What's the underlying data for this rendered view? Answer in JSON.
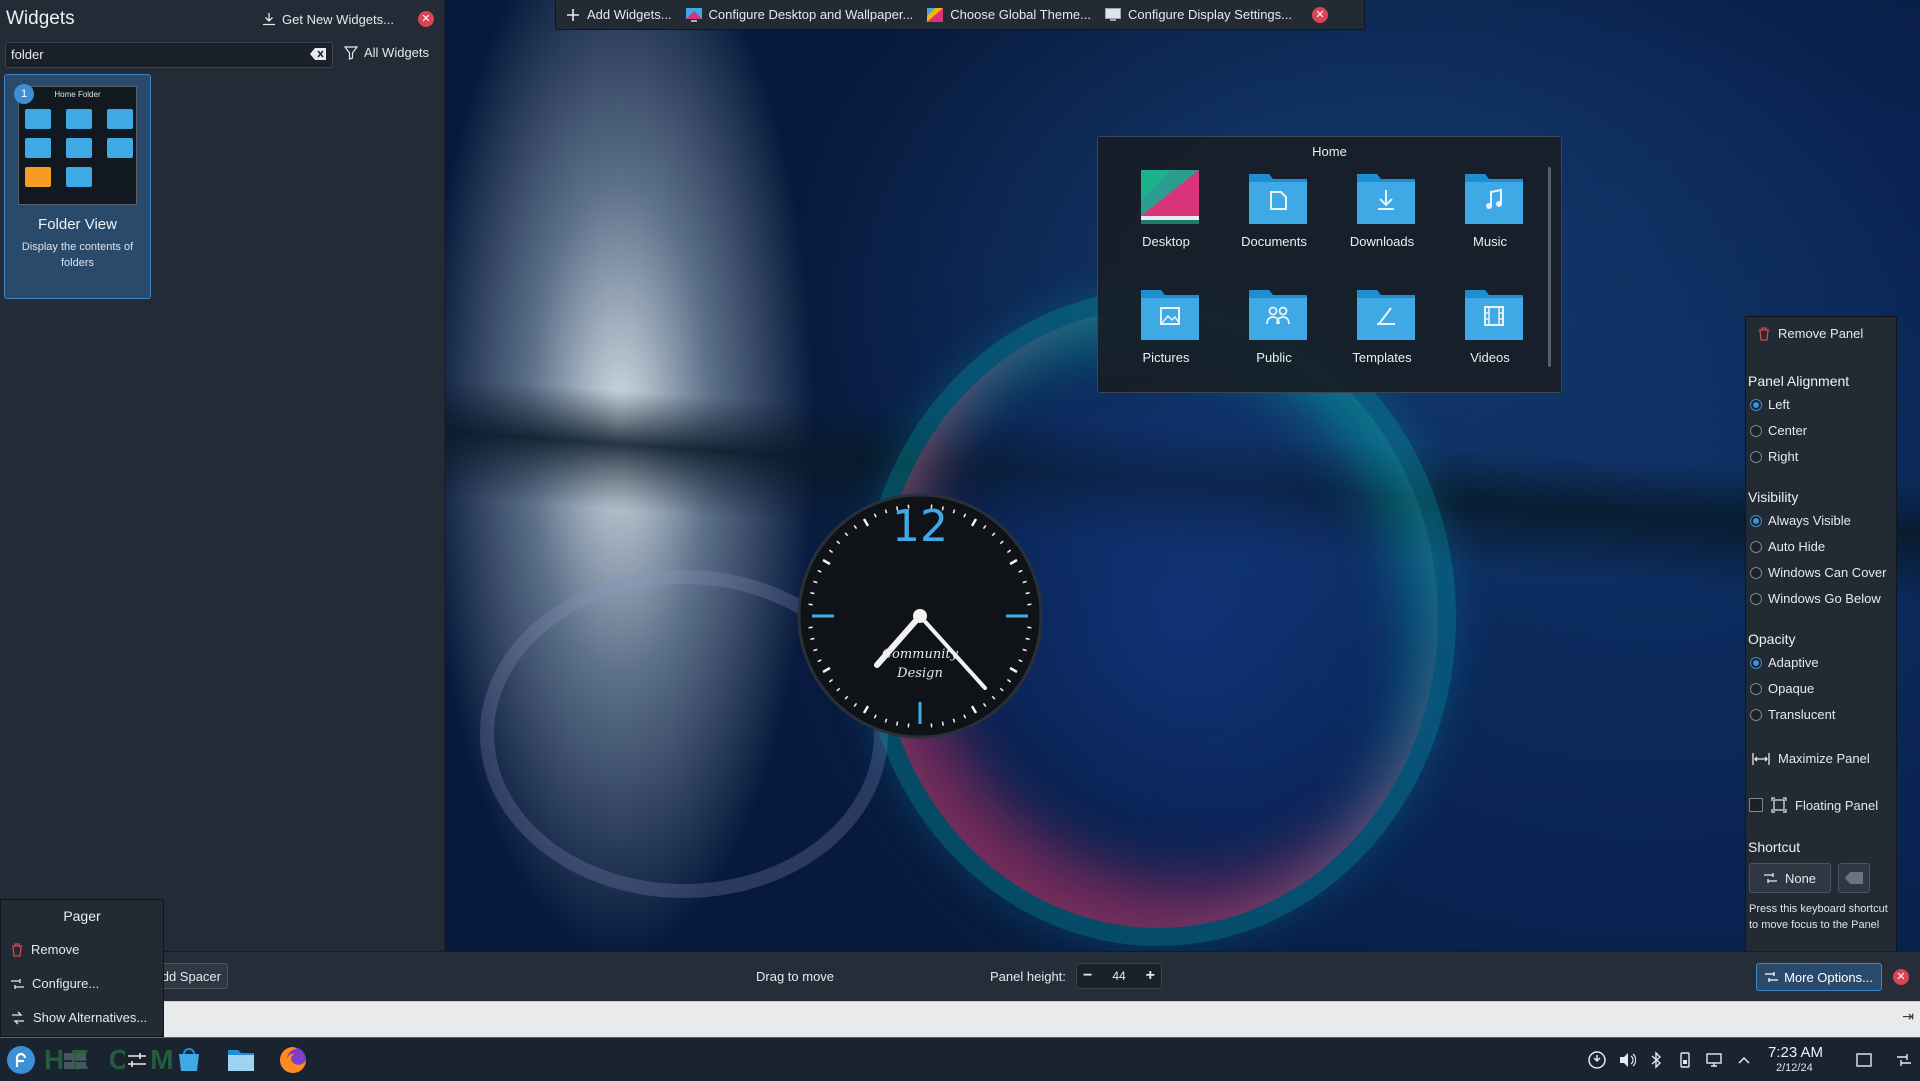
{
  "widgets_panel": {
    "title": "Widgets",
    "get_new_label": "Get New Widgets...",
    "search_value": "folder",
    "filter_label": "All Widgets",
    "card": {
      "badge": "1",
      "thumb_title": "Home Folder",
      "name": "Folder View",
      "description": "Display the contents of folders"
    }
  },
  "top_toolbar": {
    "items": [
      "Add Widgets...",
      "Configure Desktop and Wallpaper...",
      "Choose Global Theme...",
      "Configure Display Settings..."
    ]
  },
  "folder_view": {
    "title": "Home",
    "items": [
      "Desktop",
      "Documents",
      "Downloads",
      "Music",
      "Pictures",
      "Public",
      "Templates",
      "Videos"
    ]
  },
  "clock": {
    "label_line1": "Community",
    "label_line2": "Design",
    "twelve": "12"
  },
  "panel_options": {
    "remove_label": "Remove Panel",
    "alignment_title": "Panel Alignment",
    "alignment_options": [
      "Left",
      "Center",
      "Right"
    ],
    "alignment_selected": "Left",
    "visibility_title": "Visibility",
    "visibility_options": [
      "Always Visible",
      "Auto Hide",
      "Windows Can Cover",
      "Windows Go Below"
    ],
    "visibility_selected": "Always Visible",
    "opacity_title": "Opacity",
    "opacity_options": [
      "Adaptive",
      "Opaque",
      "Translucent"
    ],
    "opacity_selected": "Adaptive",
    "maximize_label": "Maximize Panel",
    "floating_label": "Floating Panel",
    "shortcut_title": "Shortcut",
    "shortcut_value": "None",
    "shortcut_note": "Press this keyboard shortcut to move focus to the Panel"
  },
  "edit_bar": {
    "add_spacer_label": "dd Spacer",
    "drag_label": "Drag to move",
    "height_label": "Panel height:",
    "height_value": "44",
    "more_options_label": "More Options..."
  },
  "context_menu": {
    "title": "Pager",
    "items": [
      "Remove",
      "Configure...",
      "Show Alternatives..."
    ]
  },
  "taskbar": {
    "time": "7:23 AM",
    "date": "2/12/24",
    "watermark": "HE      O M"
  },
  "colors": {
    "accent": "#3d8fd6",
    "close": "#da4453",
    "folder": "#3fa9e6"
  }
}
